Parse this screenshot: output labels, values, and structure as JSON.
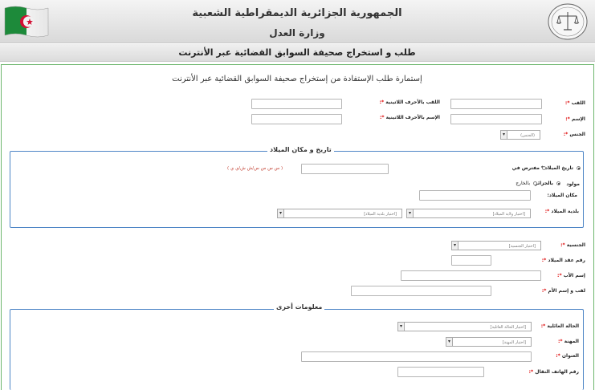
{
  "header": {
    "gov_title": "الجمهورية الجزائرية الديمقراطية الشعبية",
    "ministry": "وزارة العدل",
    "flag_icon": "algeria-flag-icon",
    "emblem_icon": "ministry-justice-emblem-icon"
  },
  "service": {
    "title": "طلب و استخراج صحيفة السوابق القضائية عبر الأنترنت"
  },
  "form": {
    "title": "إستمارة طلب الإستفادة من إستخراج صحيفة السوابق القضائية عبر الأنترنت",
    "required_mark": "*:",
    "last_name": "اللقب",
    "last_name_latin": "اللقب بالأحرف اللاتينية",
    "first_name": "الإسم",
    "first_name_latin": "الإسم بالأحرف اللاتينية",
    "gender": "الجنس",
    "gender_select": "(الجنس)",
    "birth": {
      "legend": "تاريخ و مكان الميلاد",
      "birth_date": "تاريخ الميلاد *",
      "presumed": "مفترض في",
      "date_hint": "( س س س س/ش ش/ي ي )",
      "born": "مولود",
      "in_algeria": "بالجزائر",
      "abroad": "بالخارج",
      "birth_place": "مكان الميلاد:",
      "birth_commune": "بلدية الميلاد",
      "wilaya_select": "[اختيار ولاية الميلاد]",
      "commune_select": "[اختيار بلدية الميلاد]"
    },
    "nationality": "الجنسية",
    "nationality_select": "[اختيار الجنسية]",
    "birth_cert_no": "رقم عقد الميلاد",
    "father_name": "إسم الأب",
    "mother_name": "لقب و إسم الأم",
    "other": {
      "legend": "معلومات أخرى",
      "marital_status": "الحالة العائلية",
      "marital_select": "[اختيار الحالة العائلية]",
      "profession": "المهنة",
      "profession_select": "[اختيار المهنة]",
      "address": "العنوان",
      "mobile": "رقم الهاتف النقال"
    }
  }
}
